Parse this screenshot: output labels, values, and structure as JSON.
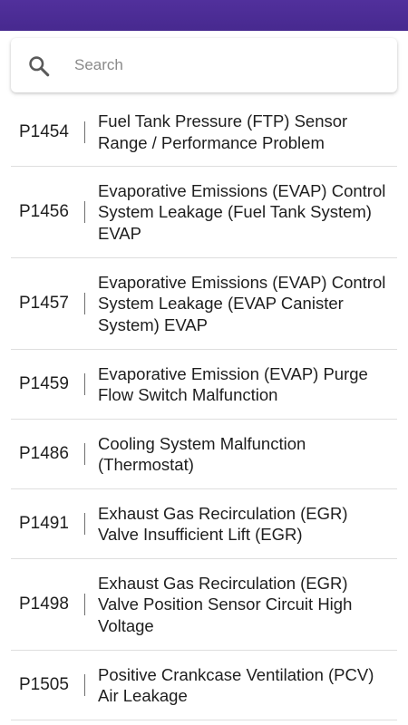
{
  "search": {
    "placeholder": "Search"
  },
  "codes": [
    {
      "code": "P1454",
      "description": "Fuel Tank Pressure (FTP) Sensor Range / Performance Problem"
    },
    {
      "code": "P1456",
      "description": "Evaporative Emissions (EVAP) Control System Leakage (Fuel Tank System) EVAP"
    },
    {
      "code": "P1457",
      "description": "Evaporative Emissions (EVAP) Control System Leakage (EVAP Canister System) EVAP"
    },
    {
      "code": "P1459",
      "description": "Evaporative Emission (EVAP) Purge Flow Switch Malfunction"
    },
    {
      "code": "P1486",
      "description": "Cooling System Malfunction (Thermostat)"
    },
    {
      "code": "P1491",
      "description": "Exhaust Gas Recirculation (EGR) Valve Insufficient Lift (EGR)"
    },
    {
      "code": "P1498",
      "description": "Exhaust Gas Recirculation (EGR) Valve Position Sensor Circuit High Voltage"
    },
    {
      "code": "P1505",
      "description": "Positive Crankcase Ventilation (PCV) Air Leakage"
    }
  ],
  "colors": {
    "status_bar": "#4b2d96",
    "divider": "#dedede",
    "placeholder": "#8a8a8a"
  }
}
